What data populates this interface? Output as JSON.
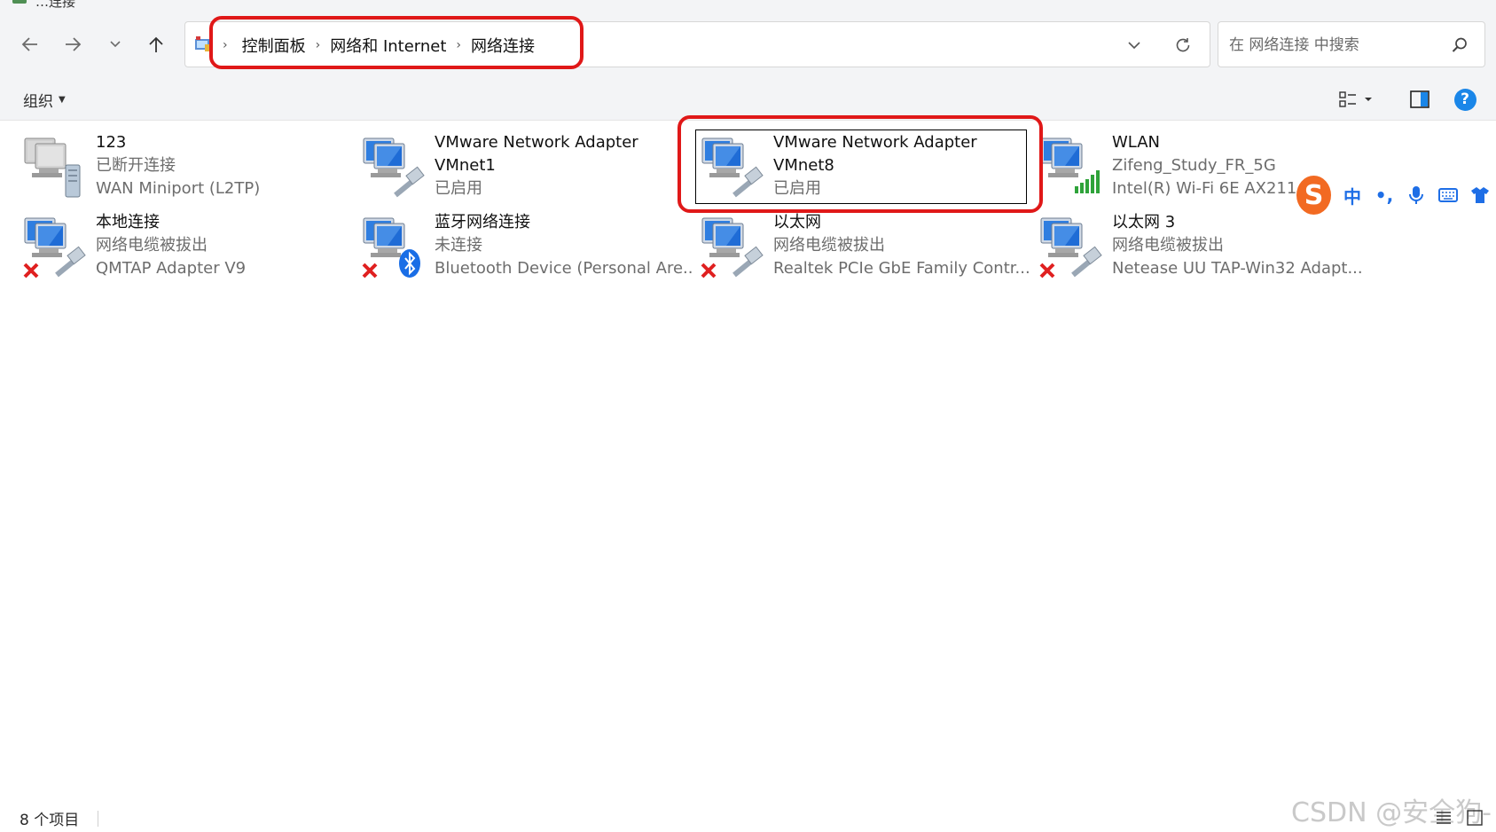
{
  "window": {
    "title_fragment": "…连接"
  },
  "nav": {
    "back": "←",
    "forward": "→",
    "recent": "⌄",
    "up": "↑"
  },
  "breadcrumb": {
    "items": [
      {
        "label": "控制面板"
      },
      {
        "label": "网络和 Internet"
      },
      {
        "label": "网络连接"
      }
    ],
    "separator": "›"
  },
  "search": {
    "placeholder": "在 网络连接 中搜索"
  },
  "command_bar": {
    "organize_label": "组织"
  },
  "items": [
    {
      "name": "123",
      "line2": "已断开连接",
      "line3": "WAN Miniport (L2TP)",
      "overlay": "server"
    },
    {
      "name": "VMware Network Adapter",
      "line2": "VMnet1",
      "line3": "已启用",
      "overlay": "cable"
    },
    {
      "name": "VMware Network Adapter",
      "line2": "VMnet8",
      "line3": "已启用",
      "overlay": "cable"
    },
    {
      "name": "WLAN",
      "line2": "Zifeng_Study_FR_5G",
      "line3": "Intel(R) Wi-Fi 6E AX211 ...",
      "overlay": "signal"
    },
    {
      "name": "本地连接",
      "line2": "网络电缆被拔出",
      "line3": "QMTAP Adapter V9",
      "overlay": "cable-x"
    },
    {
      "name": "蓝牙网络连接",
      "line2": "未连接",
      "line3": "Bluetooth Device (Personal Are...",
      "overlay": "bluetooth-x"
    },
    {
      "name": "以太网",
      "line2": "网络电缆被拔出",
      "line3": "Realtek PCIe GbE Family Contr...",
      "overlay": "cable-x"
    },
    {
      "name": "以太网 3",
      "line2": "网络电缆被拔出",
      "line3": "Netease UU TAP-Win32 Adapt...",
      "overlay": "cable-x"
    }
  ],
  "ime": {
    "logo": "S",
    "mode": "中",
    "punct": "•,",
    "voice": "mic-icon",
    "keyboard": "keyboard-icon",
    "skin": "shirt-icon"
  },
  "status": {
    "count_label": "8 个项目"
  },
  "watermark": "CSDN @安全狗-",
  "colors": {
    "highlight": "#e01818",
    "accent": "#1a86e8",
    "ime": "#f26a22"
  }
}
